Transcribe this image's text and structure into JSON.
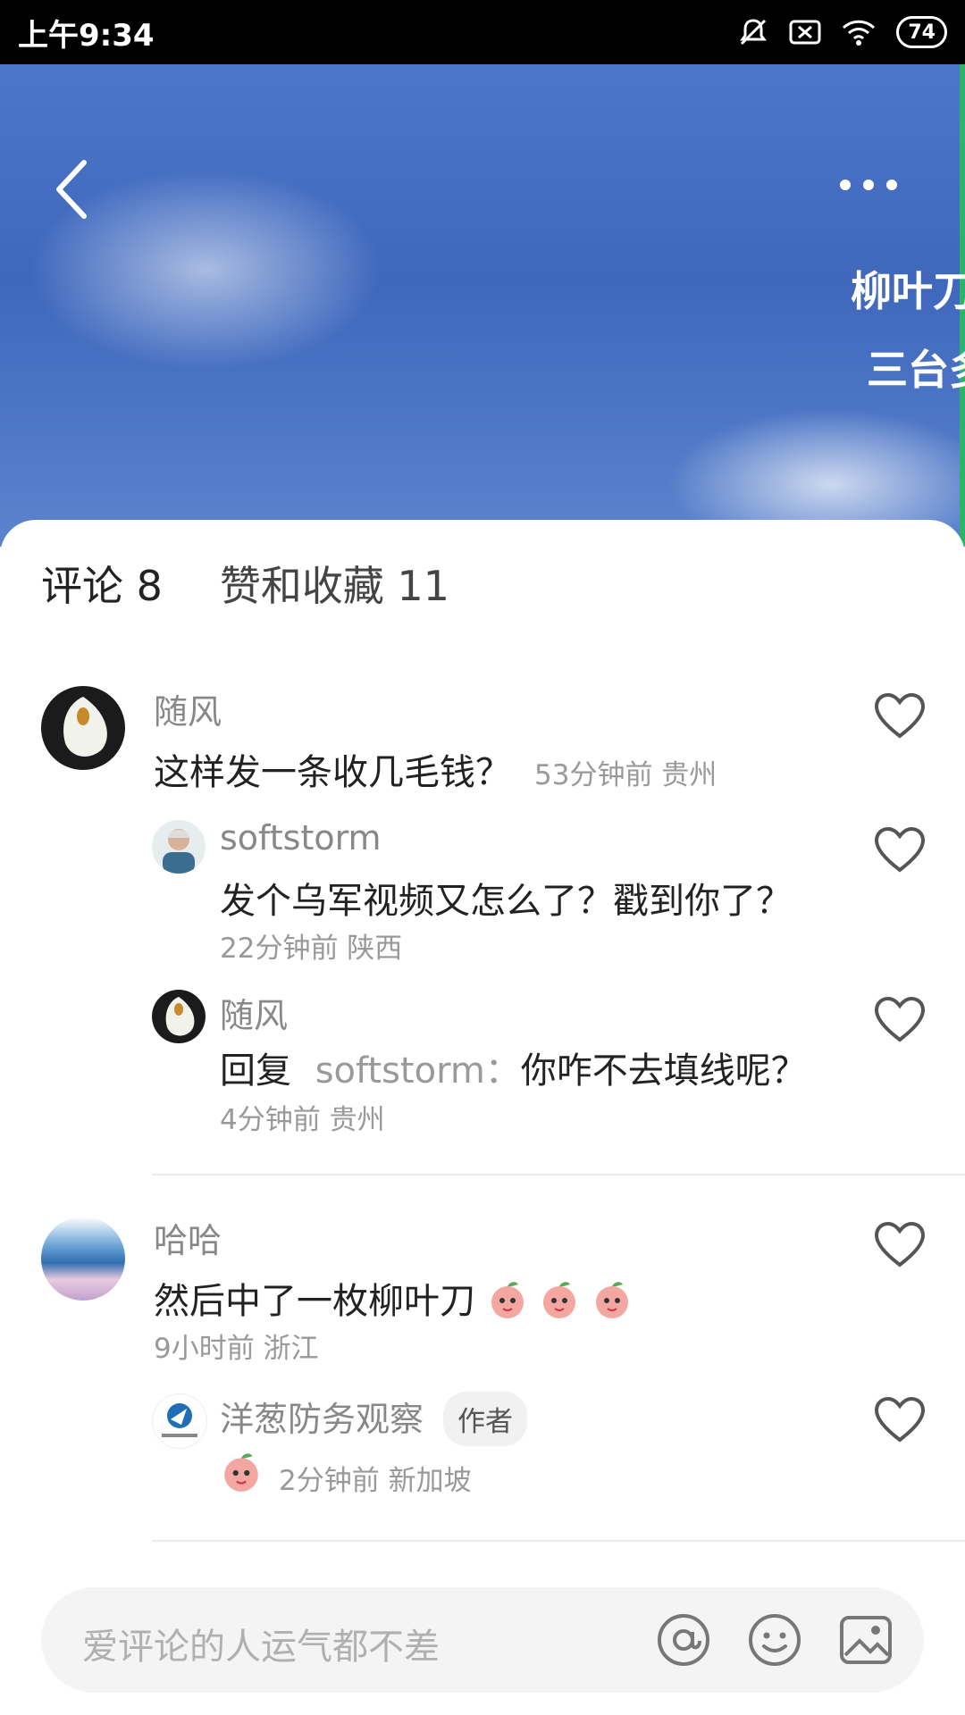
{
  "status_bar": {
    "time": "上午9:34",
    "battery": "74"
  },
  "video": {
    "overlay_title": "柳叶刀",
    "overlay_subtitle": "三台多"
  },
  "tabs": [
    {
      "label": "评论 8"
    },
    {
      "label": "赞和收藏 11"
    }
  ],
  "comments": [
    {
      "user": "随风",
      "text": "这样发一条收几毛钱？",
      "meta": "53分钟前  贵州",
      "replies": [
        {
          "user": "softstorm",
          "text": "发个乌军视频又怎么了？戳到你了？",
          "meta": "22分钟前  陕西"
        },
        {
          "user": "随风",
          "reply_prefix": "回复",
          "reply_to": "softstorm：",
          "text": "你咋不去填线呢？",
          "meta": "4分钟前  贵州"
        }
      ]
    },
    {
      "user": "哈哈",
      "text": "然后中了一枚柳叶刀",
      "meta": "9小时前  浙江",
      "replies": [
        {
          "user": "洋葱防务观察",
          "badge": "作者",
          "meta": "2分钟前  新加坡"
        }
      ]
    }
  ],
  "input": {
    "placeholder": "爱评论的人运气都不差"
  },
  "icons": {
    "back": "chevron-left-icon",
    "more": "more-dots-icon",
    "like": "heart-outline-icon",
    "mention": "at-icon",
    "emoji": "smile-icon",
    "image": "image-icon"
  }
}
